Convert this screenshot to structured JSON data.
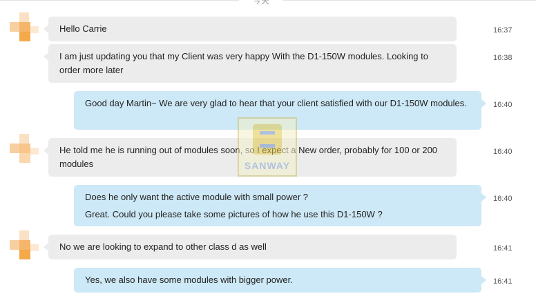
{
  "header": {
    "date_label": "今天"
  },
  "watermark": {
    "text": "SANWAY"
  },
  "colors": {
    "incoming_bubble": "#ececec",
    "outgoing_bubble": "#cde8f6",
    "avatar_orange": "#f5a94b"
  },
  "messages": [
    {
      "direction": "incoming",
      "lines": [
        "Hello Carrie"
      ],
      "time": "16:37"
    },
    {
      "direction": "incoming",
      "lines": [
        "I am just updating you that my Client was very happy With the D1-150W modules. Looking to order more later"
      ],
      "time": "16:38"
    },
    {
      "direction": "outgoing",
      "lines": [
        "Good day Martin~ We are  very glad to hear that your client satisfied with our D1-150W modules."
      ],
      "time": "16:40"
    },
    {
      "direction": "incoming",
      "lines": [
        "He told me he is running out of modules soon, so I expect a New order, probably for 100 or 200 modules"
      ],
      "time": "16:40"
    },
    {
      "direction": "outgoing",
      "lines": [
        "Does he only want the active module with small power ?",
        "Great. Could you please take some pictures of how he use this D1-150W ?"
      ],
      "time": "16:40"
    },
    {
      "direction": "incoming",
      "lines": [
        "No we are looking to expand to other class d as well"
      ],
      "time": "16:41"
    },
    {
      "direction": "outgoing",
      "lines": [
        "Yes, we also have some modules with bigger power."
      ],
      "time": "16:41"
    }
  ]
}
